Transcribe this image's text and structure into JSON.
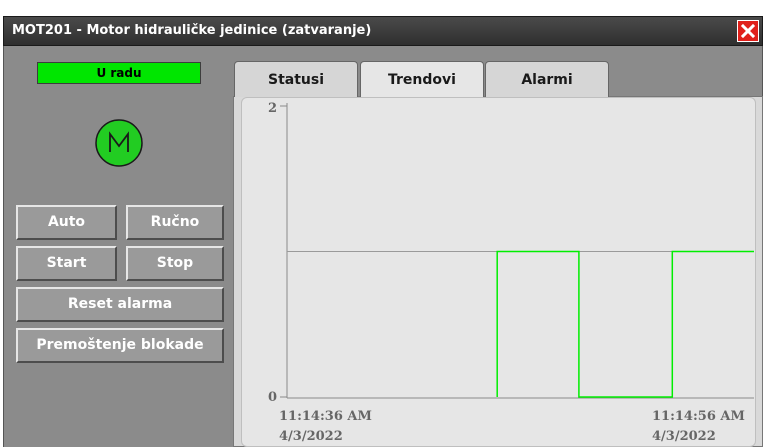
{
  "window": {
    "title": "MOT201 - Motor hidrauličke jedinice (zatvaranje)",
    "close_icon": "close-icon"
  },
  "status": {
    "label": "U radu",
    "color": "#00e600"
  },
  "motor": {
    "symbol": "M",
    "icon": "motor-icon",
    "color": "#22cc22"
  },
  "controls": {
    "auto_label": "Auto",
    "manual_label": "Ručno",
    "start_label": "Start",
    "stop_label": "Stop",
    "reset_label": "Reset alarma",
    "bypass_label": "Premoštenje blokade"
  },
  "tabs": [
    {
      "label": "Statusi",
      "active": false
    },
    {
      "label": "Trendovi",
      "active": true
    },
    {
      "label": "Alarmi",
      "active": false
    }
  ],
  "chart_data": {
    "type": "line",
    "ylim": [
      0,
      2
    ],
    "y_ticks": [
      "2",
      "0"
    ],
    "x_start": {
      "time": "11:14:36 AM",
      "date": "4/3/2022"
    },
    "x_end": {
      "time": "11:14:56 AM",
      "date": "4/3/2022"
    },
    "grid": false,
    "series": [
      {
        "color": "#00ee00",
        "step": true,
        "x": [
          0,
          9,
          9,
          12.5,
          12.5,
          16.5,
          16.5,
          20
        ],
        "values": [
          1,
          1,
          1,
          1,
          0,
          0,
          1,
          1
        ],
        "visible_from": 9
      }
    ]
  }
}
